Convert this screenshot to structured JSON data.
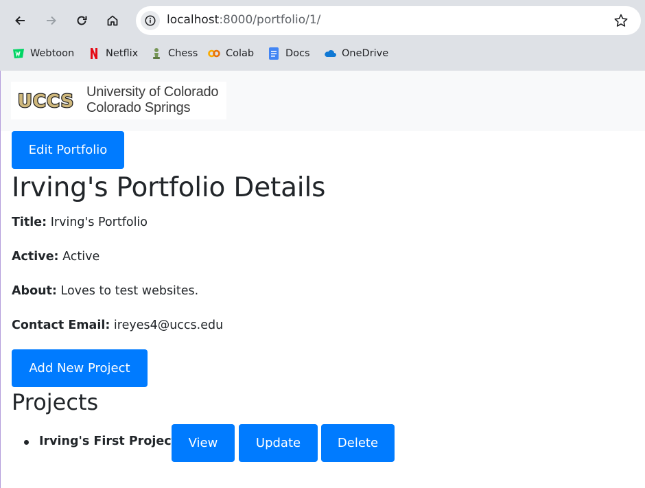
{
  "browser": {
    "url_host": "localhost",
    "url_rest": ":8000/portfolio/1/",
    "bookmarks": [
      {
        "label": "Webtoon",
        "icon": "webtoon-icon"
      },
      {
        "label": "Netflix",
        "icon": "netflix-icon"
      },
      {
        "label": "Chess",
        "icon": "chess-icon"
      },
      {
        "label": "Colab",
        "icon": "colab-icon"
      },
      {
        "label": "Docs",
        "icon": "docs-icon"
      },
      {
        "label": "OneDrive",
        "icon": "onedrive-icon"
      }
    ]
  },
  "header": {
    "logo_abbrev": "UCCS",
    "logo_line1": "University of Colorado",
    "logo_line2": "Colorado Springs"
  },
  "portfolio": {
    "edit_label": "Edit Portfolio",
    "heading": "Irving's Portfolio Details",
    "title_label": "Title:",
    "title_value": "Irving's Portfolio",
    "active_label": "Active:",
    "active_value": "Active",
    "about_label": "About:",
    "about_value": "Loves to test websites.",
    "email_label": "Contact Email:",
    "email_value": "ireyes4@uccs.edu",
    "add_project_label": "Add New Project",
    "projects_heading": "Projects",
    "projects": [
      {
        "name": "Irving's First Project",
        "view": "View",
        "update": "Update",
        "delete": "Delete"
      }
    ]
  },
  "colors": {
    "primary": "#007bff",
    "navbar_bg": "#f8f9fa",
    "chrome_bg": "#dee1e6"
  }
}
